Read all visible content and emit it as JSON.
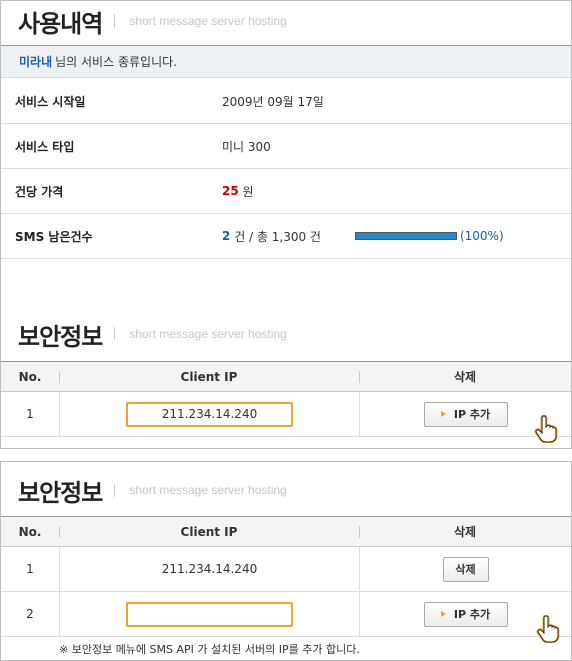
{
  "usage": {
    "title": "사용내역",
    "subtitle": "short message server hosting",
    "user_name": "미라내",
    "notice_text": "님의 서비스 종류입니다.",
    "rows": [
      {
        "label": "서비스 시작일",
        "value": "2009년 09월 17일"
      },
      {
        "label": "서비스 타입",
        "value": "미니 300"
      },
      {
        "label": "건당 가격",
        "price": "25",
        "unit": "원"
      },
      {
        "label": "SMS 남은건수",
        "remaining": "2",
        "mid": "건 / 총 1,300 건",
        "percent_text": "(100%)",
        "percent": 100
      }
    ]
  },
  "security1": {
    "title": "보안정보",
    "subtitle": "short message server hosting",
    "headers": {
      "no": "No.",
      "ip": "Client IP",
      "del": "삭제"
    },
    "rows": [
      {
        "no": "1",
        "ip_value": "211.234.14.240",
        "button": "IP 추가"
      }
    ]
  },
  "security2": {
    "title": "보안정보",
    "subtitle": "short message server hosting",
    "headers": {
      "no": "No.",
      "ip": "Client IP",
      "del": "삭제"
    },
    "rows": [
      {
        "no": "1",
        "ip": "211.234.14.240",
        "button": "삭제"
      },
      {
        "no": "2",
        "ip_value": "",
        "button": "IP 추가"
      }
    ],
    "note": "※ 보안정보 메뉴에 SMS API 가 설치된 서버의 IP를 추가 합니다."
  },
  "colors": {
    "accent": "#1a5fb4",
    "price": "#cc0000",
    "highlight": "#e8a82d",
    "progress": "#2a87c5"
  }
}
